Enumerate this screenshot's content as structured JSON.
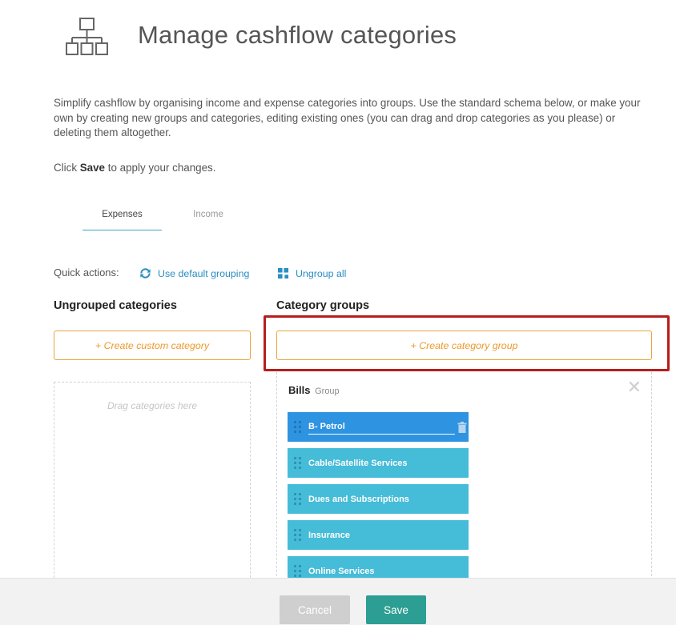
{
  "header": {
    "title": "Manage cashflow categories",
    "icon": "hierarchy-icon"
  },
  "intro": {
    "text": "Simplify cashflow by organising income and expense categories into groups. Use the standard schema below, or make your own by creating new groups and categories, editing existing ones (you can drag and drop categories as you please) or deleting them altogether.",
    "save_prefix": "Click ",
    "save_bold": "Save",
    "save_suffix": " to apply your changes."
  },
  "tabs": [
    {
      "label": "Expenses",
      "active": true
    },
    {
      "label": "Income",
      "active": false
    }
  ],
  "quick_actions": {
    "label": "Quick actions:",
    "default_grouping": "Use default grouping",
    "ungroup_all": "Ungroup all"
  },
  "ungrouped": {
    "heading": "Ungrouped categories",
    "create_label": "+ Create custom category",
    "drop_hint": "Drag categories here"
  },
  "groups": {
    "heading": "Category groups",
    "create_label": "+ Create category group",
    "items": [
      {
        "name": "Bills",
        "sub": "Group",
        "categories": [
          {
            "label": "B- Petrol",
            "editing": true
          },
          {
            "label": "Cable/Satellite Services"
          },
          {
            "label": "Dues and Subscriptions"
          },
          {
            "label": "Insurance"
          },
          {
            "label": "Online Services"
          }
        ]
      }
    ]
  },
  "footer": {
    "cancel_label": "Cancel",
    "save_label": "Save"
  },
  "colors": {
    "accent_orange": "#e9a53b",
    "category_blue": "#45bcd8",
    "category_active": "#2e93e0",
    "save_teal": "#2c9e93",
    "link_blue": "#2a8ec2",
    "highlight_red": "#b81c1c"
  }
}
